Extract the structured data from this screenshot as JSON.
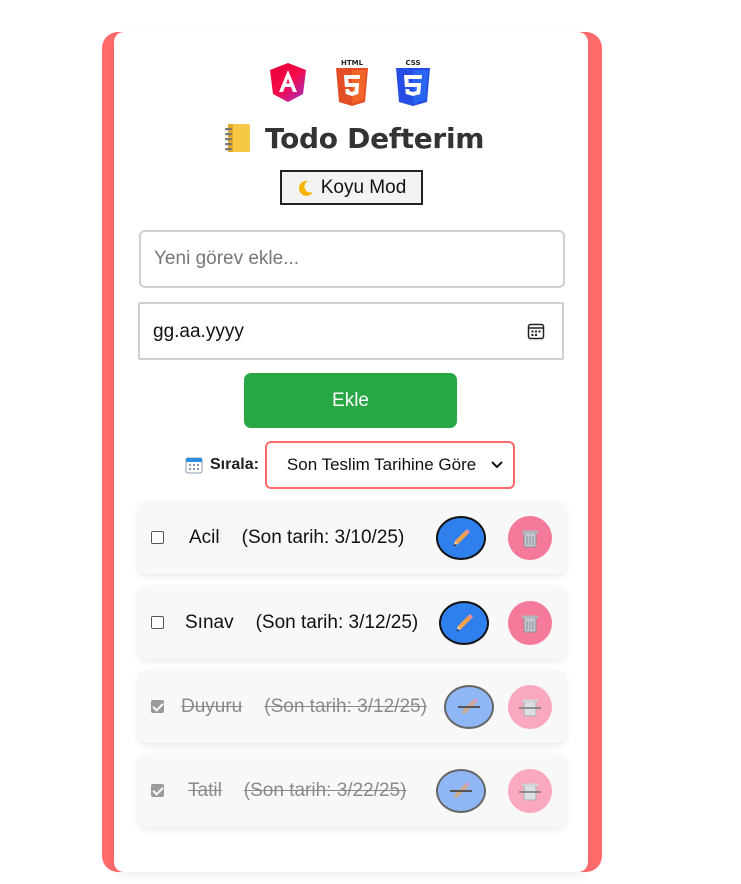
{
  "app": {
    "title": "Todo Defterim",
    "title_icon": "notebook-icon",
    "logos": [
      "angular-logo",
      "html5-logo",
      "css3-logo"
    ],
    "logo_texts": {
      "html": "HTML",
      "css": "CSS"
    }
  },
  "mode_button": {
    "icon": "moon-icon",
    "label": "Koyu Mod"
  },
  "task_input": {
    "placeholder": "Yeni görev ekle...",
    "value": ""
  },
  "date_input": {
    "value": "gg.aa.yyyy",
    "icon": "calendar-icon"
  },
  "add_button": {
    "label": "Ekle"
  },
  "sort": {
    "icon": "calendar-icon",
    "label": "Sırala:",
    "selected": "Son Teslim Tarihine Göre"
  },
  "tasks": [
    {
      "name": "Acil",
      "due": "(Son tarih: 3/10/25)",
      "completed": false
    },
    {
      "name": "Sınav",
      "due": "(Son tarih: 3/12/25)",
      "completed": false
    },
    {
      "name": "Duyuru",
      "due": "(Son tarih: 3/12/25)",
      "completed": true
    },
    {
      "name": "Tatil",
      "due": "(Son tarih: 3/22/25)",
      "completed": true
    }
  ],
  "colors": {
    "frame": "#ff6b6b",
    "add_button": "#28a745",
    "edit_button": "#2f80ed",
    "delete_button": "#f5799a"
  }
}
